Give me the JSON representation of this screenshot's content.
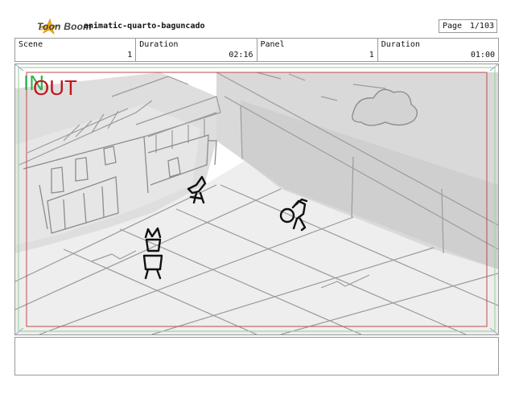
{
  "header": {
    "brand": "Toon Boom",
    "project_title": "animatic-quarto-baguncado",
    "page_label": "Page",
    "page_value": "1/103"
  },
  "info": {
    "scene_label": "Scene",
    "scene_value": "1",
    "scene_duration_label": "Duration",
    "scene_duration_value": "02:16",
    "panel_label": "Panel",
    "panel_value": "1",
    "panel_duration_label": "Duration",
    "panel_duration_value": "01:00"
  },
  "panel": {
    "in_label": "IN",
    "out_label": "OUT",
    "in_color": "#2db34a",
    "out_color": "#c0141c"
  },
  "notes": {
    "text": ""
  }
}
